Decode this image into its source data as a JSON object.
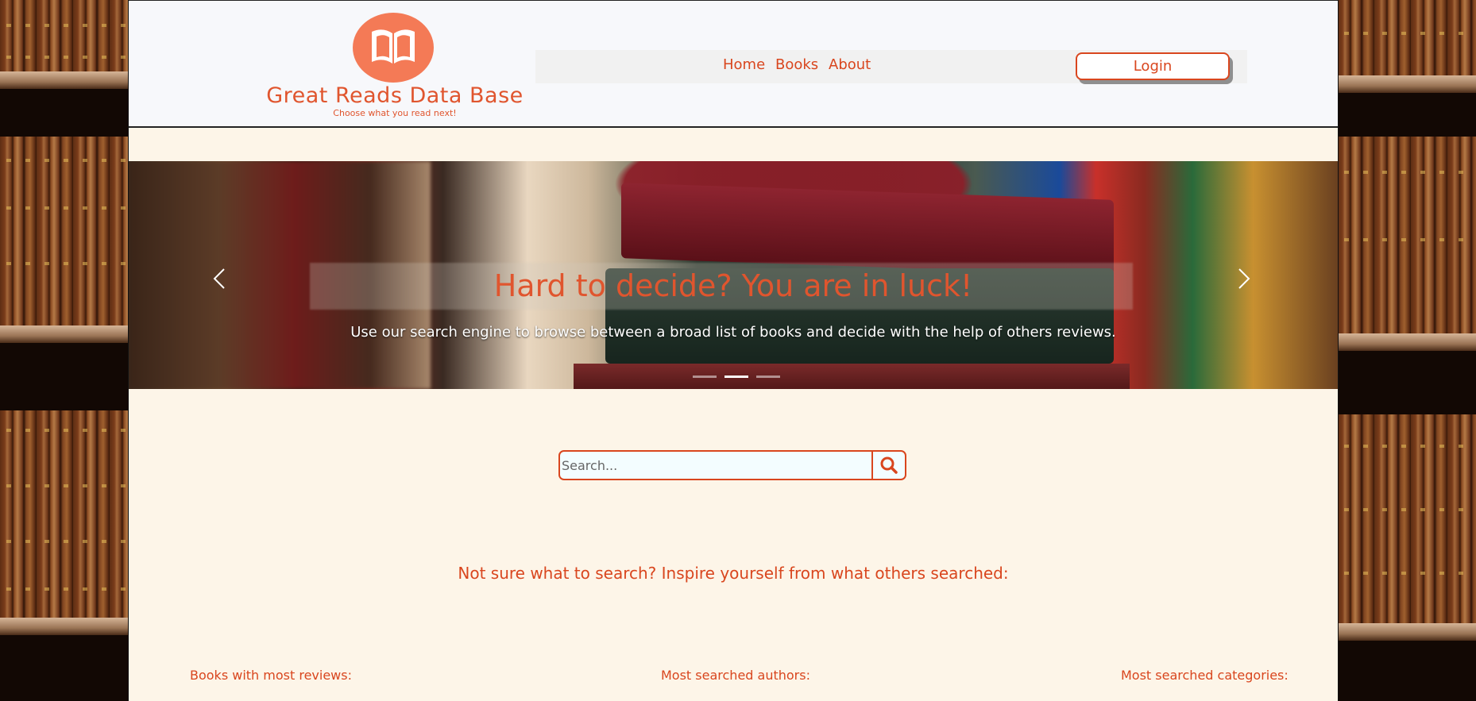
{
  "brand": {
    "title": "Great Reads Data Base",
    "tagline": "Choose what you read next!",
    "logo_icon": "open-book-icon",
    "accent_color": "#e0552e"
  },
  "nav": {
    "links": [
      "Home",
      "Books",
      "About"
    ],
    "login_label": "Login"
  },
  "carousel": {
    "title": "Hard to decide? You are in luck!",
    "subtitle": "Use our search engine to browse between a broad list of books and decide with the help of others reviews.",
    "prev_icon": "chevron-left-icon",
    "next_icon": "chevron-right-icon",
    "active_slide": 2,
    "slide_count": 3
  },
  "search": {
    "placeholder": "Search...",
    "button_icon": "search-icon"
  },
  "inspire_text": "Not sure what to search? Inspire yourself from what others searched:",
  "sections": {
    "most_reviews": "Books with most reviews:",
    "most_authors": "Most searched authors:",
    "most_categories": "Most searched categories:"
  }
}
